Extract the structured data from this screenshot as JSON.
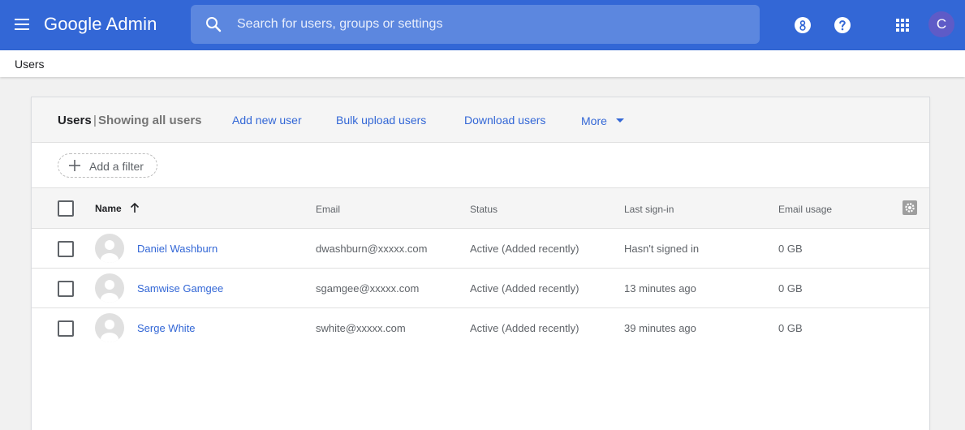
{
  "topbar": {
    "brand": "Google Admin",
    "search_placeholder": "Search for users, groups or settings",
    "avatar_letter": "C",
    "bg_color": "#3367d6",
    "icons": [
      "menu-icon",
      "search-icon",
      "support-icon",
      "help-icon",
      "apps-grid-icon"
    ]
  },
  "breadcrumb": {
    "label": "Users"
  },
  "card": {
    "title": "Users",
    "separator": "|",
    "subtitle": "Showing all users",
    "actions": {
      "add_new_user": "Add new user",
      "bulk_upload": "Bulk upload users",
      "download": "Download users",
      "more": "More"
    },
    "filter_label": "Add a filter"
  },
  "table": {
    "columns": {
      "name": "Name",
      "email": "Email",
      "status": "Status",
      "last_signin": "Last sign-in",
      "email_usage": "Email usage"
    },
    "sort": "ascending",
    "rows": [
      {
        "name": "Daniel Washburn",
        "email": "dwashburn@xxxxx.com",
        "status": "Active (Added recently)",
        "last_signin": "Hasn't signed in",
        "email_usage": "0 GB"
      },
      {
        "name": "Samwise Gamgee",
        "email": "sgamgee@xxxxx.com",
        "status": "Active (Added recently)",
        "last_signin": "13 minutes ago",
        "email_usage": "0 GB"
      },
      {
        "name": "Serge White",
        "email": "swhite@xxxxx.com",
        "status": "Active (Added recently)",
        "last_signin": "39 minutes ago",
        "email_usage": "0 GB"
      }
    ]
  }
}
